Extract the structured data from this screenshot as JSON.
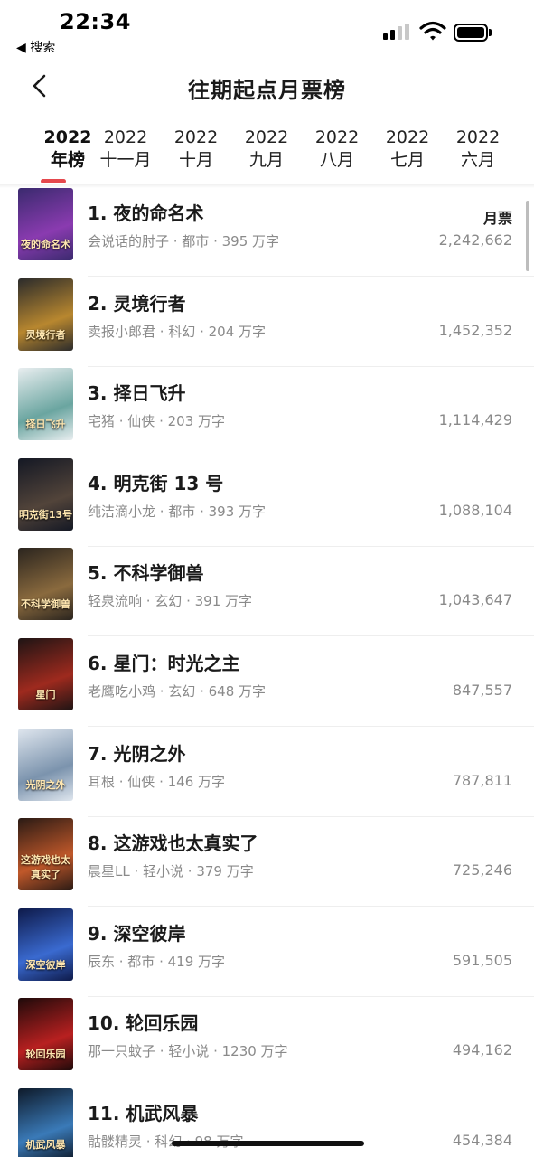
{
  "status_bar": {
    "time": "22:34",
    "back_app": "◀ 搜索"
  },
  "nav": {
    "title": "往期起点月票榜",
    "back_icon": "chevron-left-icon"
  },
  "tabs": [
    {
      "year": "2022",
      "label": "年榜",
      "active": true
    },
    {
      "year": "2022",
      "label": "十一月",
      "active": false
    },
    {
      "year": "2022",
      "label": "十月",
      "active": false
    },
    {
      "year": "2022",
      "label": "九月",
      "active": false
    },
    {
      "year": "2022",
      "label": "八月",
      "active": false
    },
    {
      "year": "2022",
      "label": "七月",
      "active": false
    },
    {
      "year": "2022",
      "label": "六月",
      "active": false
    }
  ],
  "list": {
    "column_header": "月票",
    "books": [
      {
        "title": "1. 夜的命名术",
        "meta": "会说话的肘子 · 都市 · 395 万字",
        "votes": "2,242,662",
        "cover_label": "夜的命名术",
        "cover_colors": [
          "#3a2a6e",
          "#8a3bb0"
        ]
      },
      {
        "title": "2. 灵境行者",
        "meta": "卖报小郎君 · 科幻 · 204 万字",
        "votes": "1,452,352",
        "cover_label": "灵境行者",
        "cover_colors": [
          "#2b2b2b",
          "#b8872f"
        ]
      },
      {
        "title": "3. 择日飞升",
        "meta": "宅猪 · 仙侠 · 203 万字",
        "votes": "1,114,429",
        "cover_label": "择日飞升",
        "cover_colors": [
          "#e9eef0",
          "#6aa5a0"
        ]
      },
      {
        "title": "4. 明克街 13 号",
        "meta": "纯洁滴小龙 · 都市 · 393 万字",
        "votes": "1,088,104",
        "cover_label": "明克街13号",
        "cover_colors": [
          "#141824",
          "#52443a"
        ]
      },
      {
        "title": "5. 不科学御兽",
        "meta": "轻泉流响 · 玄幻 · 391 万字",
        "votes": "1,043,647",
        "cover_label": "不科学御兽",
        "cover_colors": [
          "#2a241e",
          "#8a6a3e"
        ]
      },
      {
        "title": "6. 星门：时光之主",
        "meta": "老鹰吃小鸡 · 玄幻 · 648 万字",
        "votes": "847,557",
        "cover_label": "星门",
        "cover_colors": [
          "#1e1414",
          "#9e2a1e"
        ]
      },
      {
        "title": "7. 光阴之外",
        "meta": "耳根 · 仙侠 · 146 万字",
        "votes": "787,811",
        "cover_label": "光阴之外",
        "cover_colors": [
          "#dfe6ee",
          "#7b93ad"
        ]
      },
      {
        "title": "8. 这游戏也太真实了",
        "meta": "晨星LL · 轻小说 · 379 万字",
        "votes": "725,246",
        "cover_label": "这游戏也太真实了",
        "cover_colors": [
          "#2a1a14",
          "#c0582a"
        ]
      },
      {
        "title": "9. 深空彼岸",
        "meta": "辰东 · 都市 · 419 万字",
        "votes": "591,505",
        "cover_label": "深空彼岸",
        "cover_colors": [
          "#0e1a4a",
          "#3a6ad0"
        ]
      },
      {
        "title": "10. 轮回乐园",
        "meta": "那一只蚊子 · 轻小说 · 1230 万字",
        "votes": "494,162",
        "cover_label": "轮回乐园",
        "cover_colors": [
          "#1e0a0a",
          "#b82020"
        ]
      },
      {
        "title": "11. 机武风暴",
        "meta": "骷髅精灵 · 科幻 · 98 万字",
        "votes": "454,384",
        "cover_label": "机武风暴",
        "cover_colors": [
          "#0e1a2a",
          "#3a7ab8"
        ]
      }
    ]
  },
  "colors": {
    "accent": "#e5484d",
    "meta_text": "#8a8a8a",
    "title_text": "#1a1a1a"
  }
}
